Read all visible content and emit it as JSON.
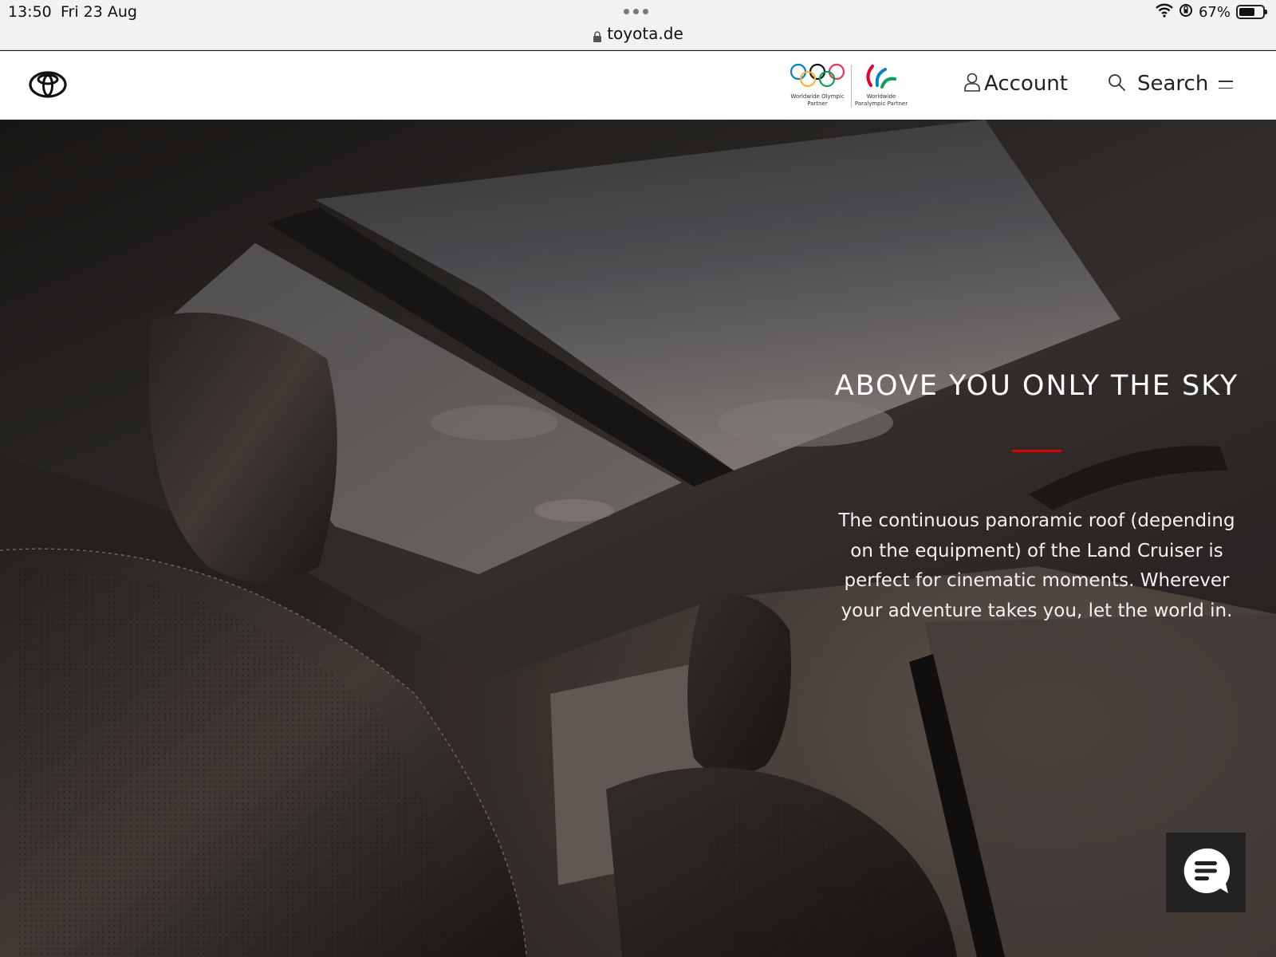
{
  "status_bar": {
    "time": "13:50",
    "date": "Fri 23 Aug",
    "battery_percent": "67%",
    "battery_level": 0.67
  },
  "browser": {
    "url": "toyota.de"
  },
  "header": {
    "partners": {
      "olympic_caption": "Worldwide Olympic Partner",
      "paralympic_caption": "Worldwide Paralympic Partner"
    },
    "account_label": "Account",
    "search_label": "Search"
  },
  "hero": {
    "title": "ABOVE YOU ONLY THE SKY",
    "body": "The continuous panoramic roof (depending on the equipment) of the Land Cruiser is perfect for cinematic moments. Wherever your adventure takes you, let the world in."
  },
  "colors": {
    "accent_red": "#e50000",
    "header_bg": "#ffffff",
    "chat_bg": "#222222"
  },
  "icons": [
    "lock-icon",
    "wifi-icon",
    "orientation-lock-icon",
    "battery-icon",
    "toyota-logo",
    "person-icon",
    "search-icon",
    "menu-icon",
    "chat-icon"
  ]
}
